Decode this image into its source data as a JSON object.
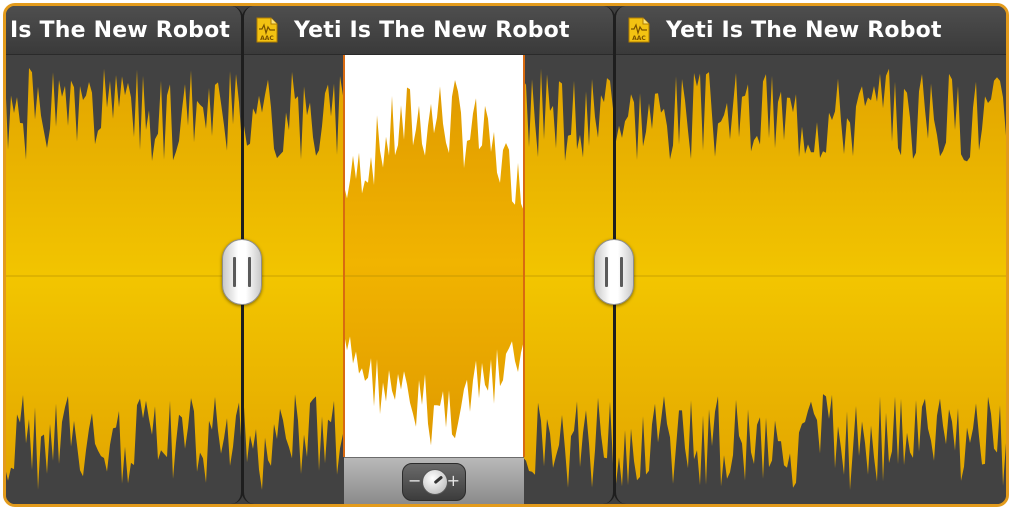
{
  "clips": [
    {
      "title": "Is The New Robot",
      "icon": "aac-file-icon"
    },
    {
      "title": "Yeti Is The New Robot",
      "icon": "aac-file-icon"
    },
    {
      "title": "Yeti Is The New Robot",
      "icon": "aac-file-icon"
    }
  ],
  "file_badge": "AAC",
  "volume_control": {
    "minus_label": "−",
    "plus_label": "+"
  },
  "colors": {
    "accent_border": "#e39b1c",
    "waveform": "#f2c500",
    "waveform_dark": "#e2a400",
    "selected_waveform": "#e8a800",
    "selection_background": "#ffffff",
    "clip_background": "#424242",
    "selection_edge": "#d86a10"
  }
}
